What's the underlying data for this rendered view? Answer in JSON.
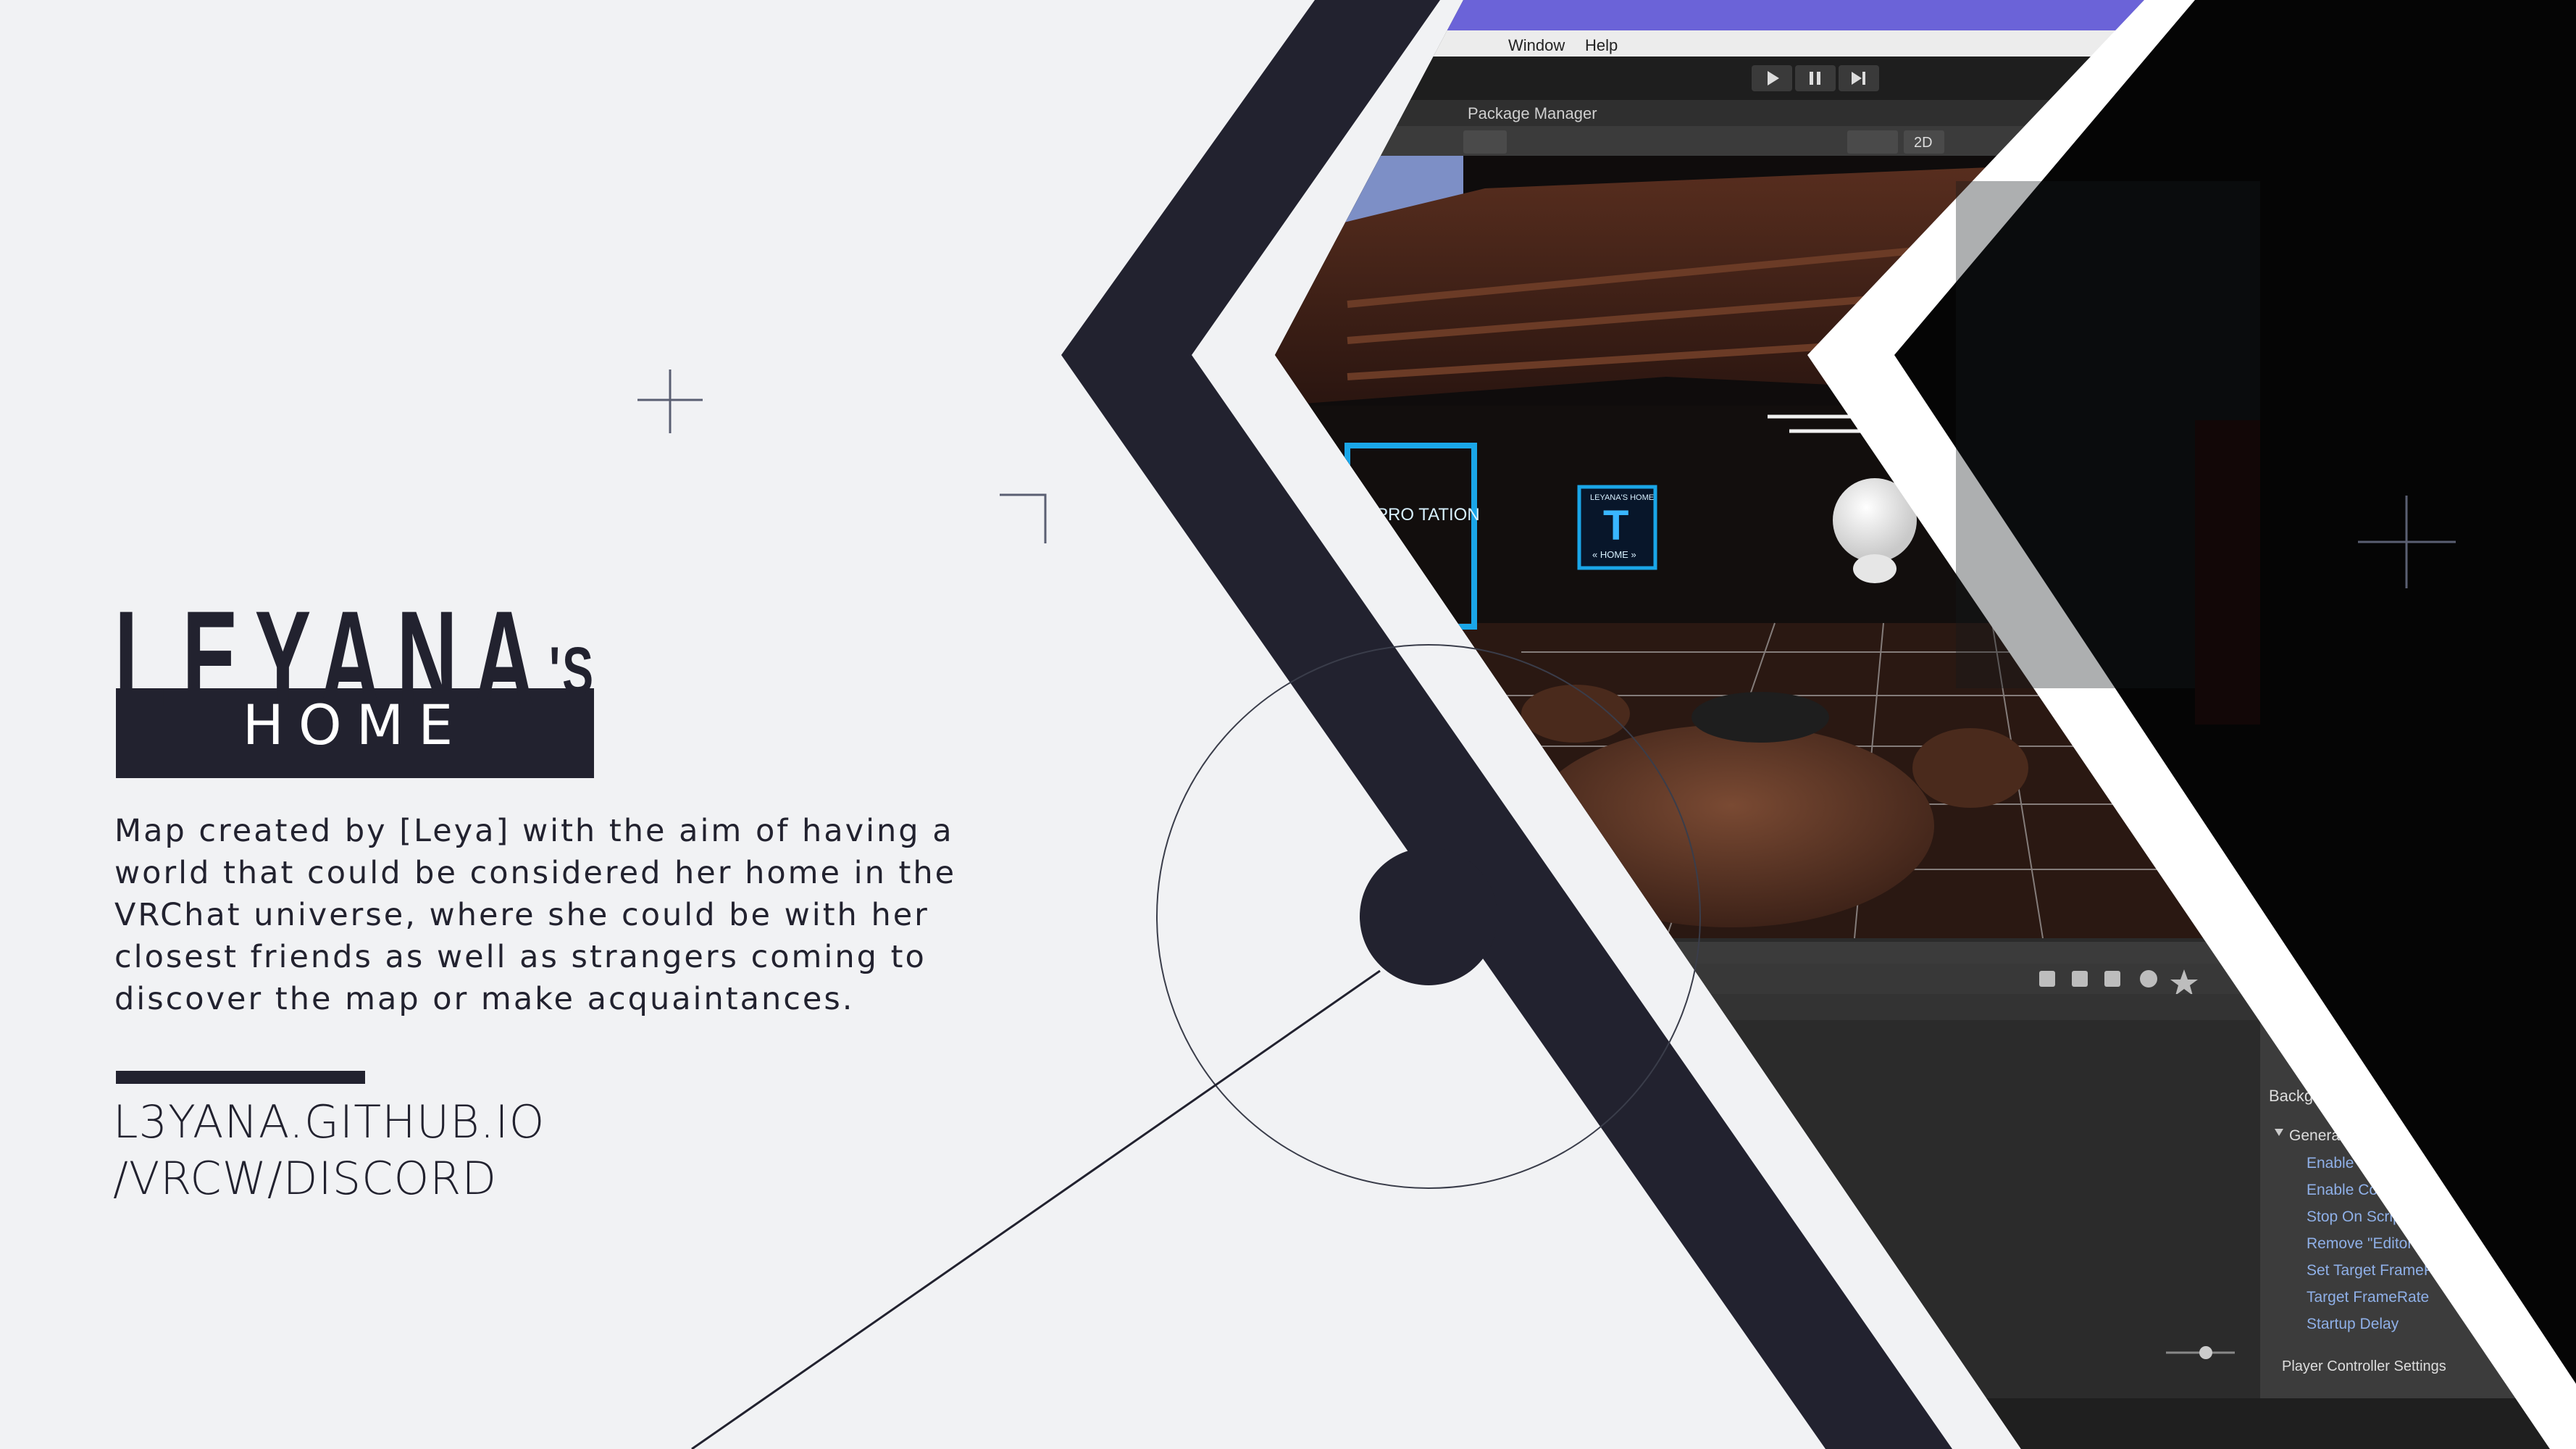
{
  "logo": {
    "name": "LEYANA",
    "possessive": "'S",
    "subtitle": "HOME"
  },
  "description": "Map created by [Leya] with the aim of having a world that could be considered her home in the VRChat universe, where she could be with her closest friends as well as strangers coming to discover the map or make acquaintances.",
  "link": {
    "line1": "L3YANA.GITHUB.IO",
    "line2": "/VRCW/DISCORD"
  },
  "editor": {
    "menu": [
      "Window",
      "Help"
    ],
    "tab_label": "Package Manager",
    "view_mode": "2D",
    "inspector_header": "Backgro",
    "inspector_items": [
      "General S",
      "Enable C",
      "Enable Con",
      "Stop On Scrip",
      "Remove \"EditorO",
      "Set Target FrameR",
      "Target FrameRate",
      "Startup Delay"
    ],
    "footer_item": "Player Controller Settings"
  },
  "scene": {
    "sign_left": "PRO TATION",
    "sign_center_title": "LEYANA'S HOME",
    "sign_center_letter": "T",
    "sign_center_caption": "« HOME »"
  },
  "colors": {
    "background": "#f1f2f4",
    "dark_navy": "#22222f",
    "editor_title_bar": "#6b63d8",
    "white": "#ffffff"
  }
}
